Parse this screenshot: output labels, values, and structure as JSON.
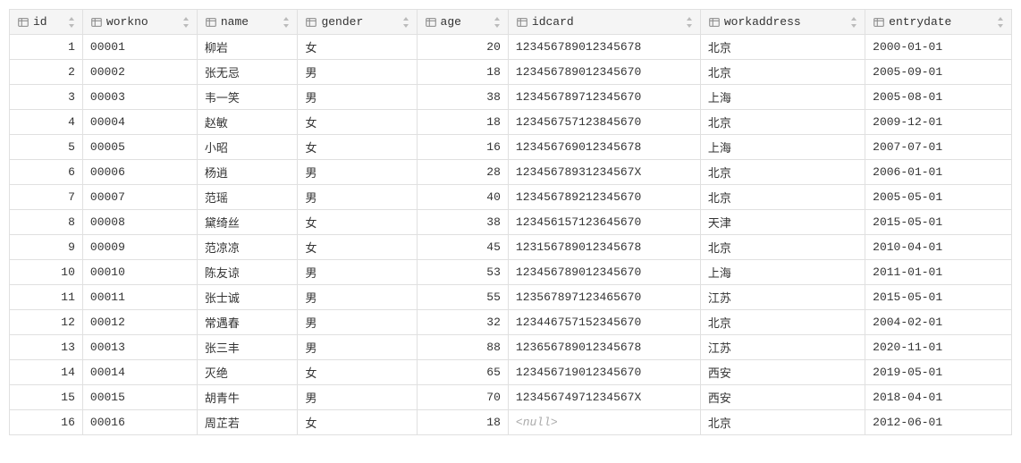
{
  "columns": [
    {
      "key": "id",
      "label": "id",
      "type": "num"
    },
    {
      "key": "workno",
      "label": "workno",
      "type": "text"
    },
    {
      "key": "name",
      "label": "name",
      "type": "text"
    },
    {
      "key": "gender",
      "label": "gender",
      "type": "text"
    },
    {
      "key": "age",
      "label": "age",
      "type": "num"
    },
    {
      "key": "idcard",
      "label": "idcard",
      "type": "text"
    },
    {
      "key": "workaddress",
      "label": "workaddress",
      "type": "text"
    },
    {
      "key": "entrydate",
      "label": "entrydate",
      "type": "text"
    }
  ],
  "null_display": "<null>",
  "rows": [
    {
      "id": 1,
      "workno": "00001",
      "name": "柳岩",
      "gender": "女",
      "age": 20,
      "idcard": "123456789012345678",
      "workaddress": "北京",
      "entrydate": "2000-01-01"
    },
    {
      "id": 2,
      "workno": "00002",
      "name": "张无忌",
      "gender": "男",
      "age": 18,
      "idcard": "123456789012345670",
      "workaddress": "北京",
      "entrydate": "2005-09-01"
    },
    {
      "id": 3,
      "workno": "00003",
      "name": "韦一笑",
      "gender": "男",
      "age": 38,
      "idcard": "123456789712345670",
      "workaddress": "上海",
      "entrydate": "2005-08-01"
    },
    {
      "id": 4,
      "workno": "00004",
      "name": "赵敏",
      "gender": "女",
      "age": 18,
      "idcard": "123456757123845670",
      "workaddress": "北京",
      "entrydate": "2009-12-01"
    },
    {
      "id": 5,
      "workno": "00005",
      "name": "小昭",
      "gender": "女",
      "age": 16,
      "idcard": "123456769012345678",
      "workaddress": "上海",
      "entrydate": "2007-07-01"
    },
    {
      "id": 6,
      "workno": "00006",
      "name": "杨逍",
      "gender": "男",
      "age": 28,
      "idcard": "12345678931234567X",
      "workaddress": "北京",
      "entrydate": "2006-01-01"
    },
    {
      "id": 7,
      "workno": "00007",
      "name": "范瑶",
      "gender": "男",
      "age": 40,
      "idcard": "123456789212345670",
      "workaddress": "北京",
      "entrydate": "2005-05-01"
    },
    {
      "id": 8,
      "workno": "00008",
      "name": "黛绮丝",
      "gender": "女",
      "age": 38,
      "idcard": "123456157123645670",
      "workaddress": "天津",
      "entrydate": "2015-05-01"
    },
    {
      "id": 9,
      "workno": "00009",
      "name": "范凉凉",
      "gender": "女",
      "age": 45,
      "idcard": "123156789012345678",
      "workaddress": "北京",
      "entrydate": "2010-04-01"
    },
    {
      "id": 10,
      "workno": "00010",
      "name": "陈友谅",
      "gender": "男",
      "age": 53,
      "idcard": "123456789012345670",
      "workaddress": "上海",
      "entrydate": "2011-01-01"
    },
    {
      "id": 11,
      "workno": "00011",
      "name": "张士诚",
      "gender": "男",
      "age": 55,
      "idcard": "123567897123465670",
      "workaddress": "江苏",
      "entrydate": "2015-05-01"
    },
    {
      "id": 12,
      "workno": "00012",
      "name": "常遇春",
      "gender": "男",
      "age": 32,
      "idcard": "123446757152345670",
      "workaddress": "北京",
      "entrydate": "2004-02-01"
    },
    {
      "id": 13,
      "workno": "00013",
      "name": "张三丰",
      "gender": "男",
      "age": 88,
      "idcard": "123656789012345678",
      "workaddress": "江苏",
      "entrydate": "2020-11-01"
    },
    {
      "id": 14,
      "workno": "00014",
      "name": "灭绝",
      "gender": "女",
      "age": 65,
      "idcard": "123456719012345670",
      "workaddress": "西安",
      "entrydate": "2019-05-01"
    },
    {
      "id": 15,
      "workno": "00015",
      "name": "胡青牛",
      "gender": "男",
      "age": 70,
      "idcard": "12345674971234567X",
      "workaddress": "西安",
      "entrydate": "2018-04-01"
    },
    {
      "id": 16,
      "workno": "00016",
      "name": "周芷若",
      "gender": "女",
      "age": 18,
      "idcard": null,
      "workaddress": "北京",
      "entrydate": "2012-06-01"
    }
  ]
}
